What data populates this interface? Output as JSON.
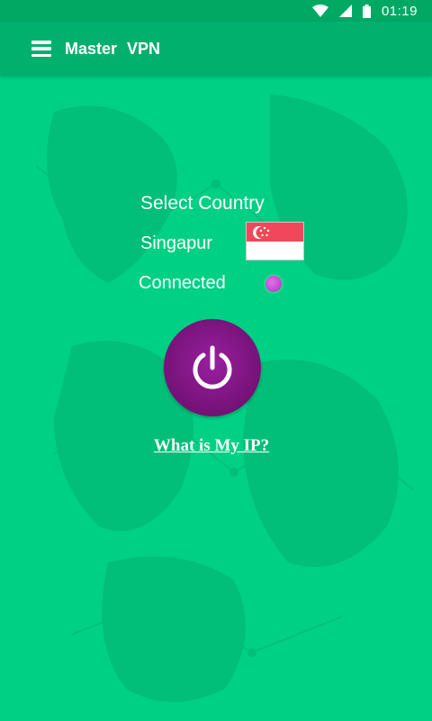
{
  "status_bar": {
    "time": "01:19",
    "icons": [
      "wifi-icon",
      "cellular-signal-icon",
      "battery-icon"
    ],
    "background": "#00a864"
  },
  "app_bar": {
    "title": "Master  VPN",
    "menu_icon": "hamburger-menu-icon",
    "background": "#00b06c"
  },
  "main": {
    "background": "#00d084",
    "select_country_label": "Select Country",
    "country": "Singapur",
    "flag_icon": "singapore-flag-icon",
    "connection_status": "Connected",
    "status_indicator_color": "#c040d0",
    "power_icon": "power-icon",
    "power_button_color": "#8a1890",
    "ip_link": "What is My IP?"
  }
}
